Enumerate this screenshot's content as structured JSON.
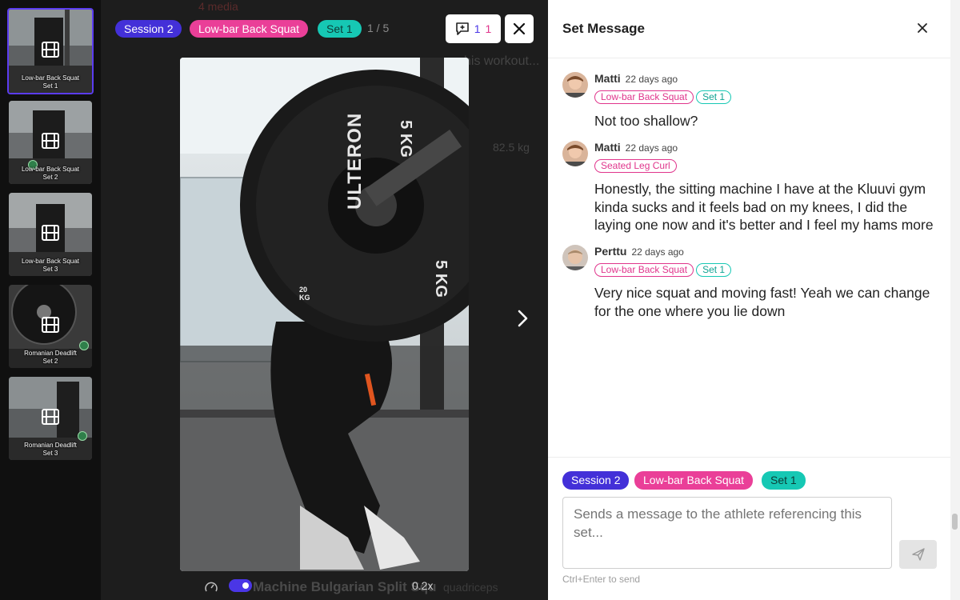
{
  "thumbnails": [
    {
      "exercise": "Low-bar Back Squat",
      "set": "Set 1",
      "active": true
    },
    {
      "exercise": "Low-bar Back Squat",
      "set": "Set 2",
      "active": false
    },
    {
      "exercise": "Low-bar Back Squat",
      "set": "Set 3",
      "active": false
    },
    {
      "exercise": "Romanian Deadlift",
      "set": "Set 2",
      "active": false
    },
    {
      "exercise": "Romanian Deadlift",
      "set": "Set 3",
      "active": false
    }
  ],
  "background": {
    "media_count": "4 media",
    "workout_note": "his workout...",
    "weight": "82.5 kg",
    "next_exercise": "Machine Bulgarian Split Squ",
    "muscle": "quadriceps"
  },
  "viewer": {
    "session_chip": "Session 2",
    "exercise_chip": "Low-bar Back Squat",
    "set_chip": "Set 1",
    "counter": "1 / 5",
    "message_count_a": "1",
    "message_count_b": "1",
    "speed": "0.2x",
    "plate_brand": "ULTERON",
    "plate_weight": "5",
    "plate_unit": "KG",
    "small_plate": "20 KG"
  },
  "panel": {
    "title": "Set Message",
    "messages": [
      {
        "author": "Matti",
        "time": "22 days ago",
        "tags": [
          "Low-bar Back Squat",
          "Set 1"
        ],
        "body": "Not too shallow?"
      },
      {
        "author": "Matti",
        "time": "22 days ago",
        "tags": [
          "Seated Leg Curl"
        ],
        "body": "Honestly, the sitting machine I have at the Kluuvi gym kinda sucks and it feels bad on my knees, I did the laying one now and it's better and I feel my hams more"
      },
      {
        "author": "Perttu",
        "time": "22 days ago",
        "tags": [
          "Low-bar Back Squat",
          "Set 1"
        ],
        "body": "Very nice squat and moving fast! Yeah we can change for the one where you lie down"
      }
    ],
    "composer": {
      "session_chip": "Session 2",
      "exercise_chip": "Low-bar Back Squat",
      "set_chip": "Set 1",
      "placeholder": "Sends a message to the athlete referencing this set...",
      "hint": "Ctrl+Enter to send"
    }
  },
  "colors": {
    "session": "#4330d8",
    "exercise": "#ea3f98",
    "set": "#16c8b4",
    "accent": "#5b3cf0"
  }
}
